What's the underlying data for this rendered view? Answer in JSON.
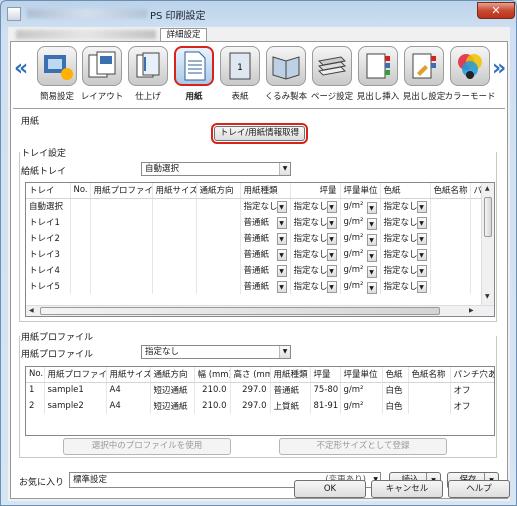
{
  "window": {
    "title": "PS 印刷設定",
    "close_glyph": "✕"
  },
  "tabs": {
    "active": "詳細設定"
  },
  "ribbon": {
    "left_arrow": "«",
    "right_arrow": "»",
    "items": [
      {
        "label": "簡易設定",
        "icon": "quick-setting-icon"
      },
      {
        "label": "レイアウト",
        "icon": "layout-icon"
      },
      {
        "label": "仕上げ",
        "icon": "finishing-icon"
      },
      {
        "label": "用紙",
        "icon": "paper-icon",
        "selected": true
      },
      {
        "label": "表紙",
        "icon": "cover-icon"
      },
      {
        "label": "くるみ製本",
        "icon": "perfect-bind-icon"
      },
      {
        "label": "ページ設定",
        "icon": "page-setting-icon"
      },
      {
        "label": "見出し挿入",
        "icon": "tab-insert-icon"
      },
      {
        "label": "見出し設定",
        "icon": "tab-setting-icon"
      },
      {
        "label": "カラーモード",
        "icon": "color-mode-icon"
      }
    ]
  },
  "paper": {
    "section_title": "用紙",
    "get_info_button": "トレイ/用紙情報取得",
    "tray_settings_title": "トレイ設定",
    "feed_tray_label": "給紙トレイ",
    "feed_tray_value": "自動選択"
  },
  "tray_table": {
    "headers": [
      "トレイ",
      "No.",
      "用紙プロファイル",
      "用紙サイズ",
      "通紙方向",
      "用紙種類",
      "坪量",
      "坪量単位",
      "色紙",
      "色紙名称",
      "パ"
    ],
    "rows": [
      {
        "tray": "自動選択",
        "type": "指定なし",
        "weight": "指定なし",
        "unit": "g/m²",
        "color": "指定なし"
      },
      {
        "tray": "トレイ1",
        "type": "普通紙",
        "weight": "指定なし",
        "unit": "g/m²",
        "color": "指定なし"
      },
      {
        "tray": "トレイ2",
        "type": "普通紙",
        "weight": "指定なし",
        "unit": "g/m²",
        "color": "指定なし"
      },
      {
        "tray": "トレイ3",
        "type": "普通紙",
        "weight": "指定なし",
        "unit": "g/m²",
        "color": "指定なし"
      },
      {
        "tray": "トレイ4",
        "type": "普通紙",
        "weight": "指定なし",
        "unit": "g/m²",
        "color": "指定なし"
      },
      {
        "tray": "トレイ5",
        "type": "普通紙",
        "weight": "指定なし",
        "unit": "g/m²",
        "color": "指定なし"
      }
    ]
  },
  "profile": {
    "section_title": "用紙プロファイル",
    "label": "用紙プロファイル",
    "value": "指定なし",
    "use_button": "選択中のプロファイルを使用",
    "register_button": "不定形サイズとして登録"
  },
  "profile_table": {
    "headers": [
      "No.",
      "用紙プロファイル",
      "用紙サイズ",
      "通紙方向",
      "幅 (mm)",
      "高さ (mm)",
      "用紙種類",
      "坪量",
      "坪量単位",
      "色紙",
      "色紙名称",
      "パンチ穴あ"
    ],
    "rows": [
      [
        "1",
        "sample1",
        "A4",
        "短辺通紙",
        "210.0",
        "297.0",
        "普通紙",
        "75-80",
        "g/m²",
        "白色",
        "",
        "オフ"
      ],
      [
        "2",
        "sample2",
        "A4",
        "短辺通紙",
        "210.0",
        "297.0",
        "上質紙",
        "81-91",
        "g/m²",
        "白色",
        "",
        "オフ"
      ]
    ]
  },
  "footer": {
    "favorite_label": "お気に入り",
    "favorite_value": "標準設定",
    "changed_note": "(変更あり)",
    "load_button": "読込",
    "save_button": "保存",
    "ok_button": "OK",
    "cancel_button": "キャンセル",
    "help_button": "ヘルプ"
  },
  "colors": {
    "accent_highlight": "#d9231a",
    "ribbon_arrow": "#2f6fb8",
    "window_frame": "#bcd3ea"
  }
}
